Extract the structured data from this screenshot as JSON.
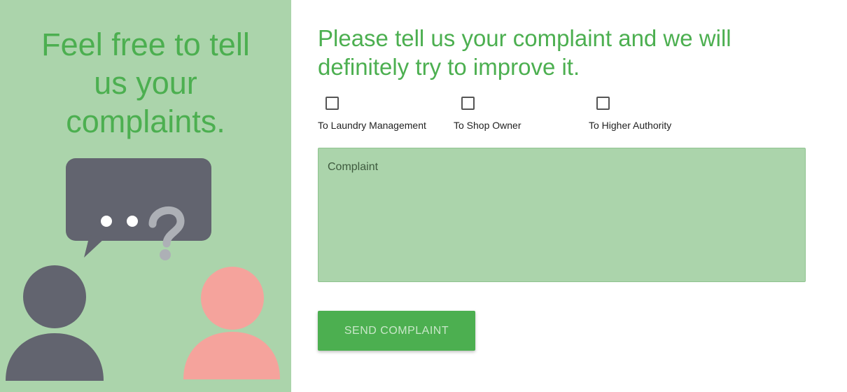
{
  "left_panel": {
    "heading": "Feel free to tell us your complaints.",
    "speech_bubble_text": "• • ?"
  },
  "form": {
    "title": "Please tell us your complaint and we will definitely try to improve it.",
    "options": [
      {
        "label": "To Laundry Management",
        "checked": false
      },
      {
        "label": "To Shop Owner",
        "checked": false
      },
      {
        "label": "To Higher Authority",
        "checked": false
      }
    ],
    "complaint_placeholder": "Complaint",
    "complaint_value": "",
    "submit_label": "SEND COMPLAINT"
  },
  "colors": {
    "accent": "#4caf50",
    "panel_bg": "#abd4ab",
    "person_dark": "#62646f",
    "person_pink": "#f5a39c"
  }
}
